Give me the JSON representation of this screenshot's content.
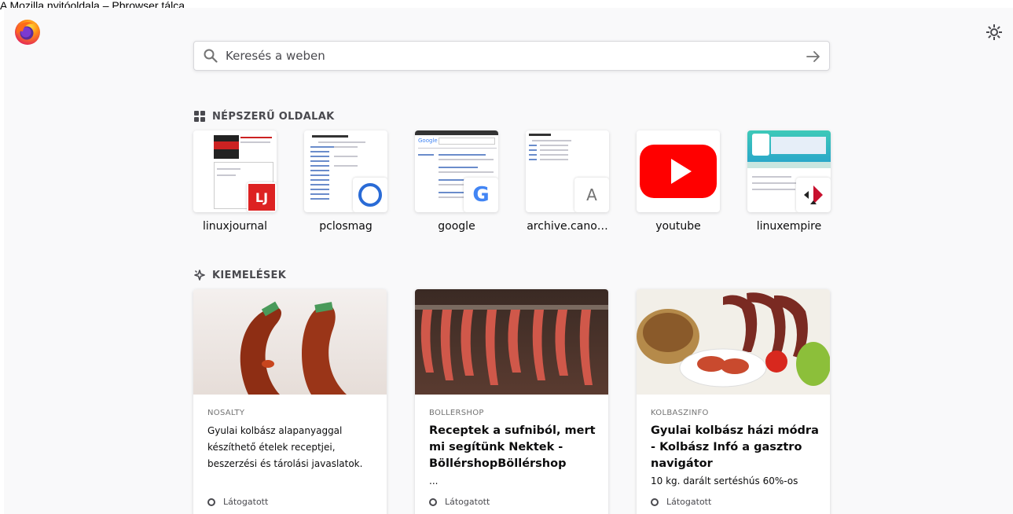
{
  "window": {
    "title": "A Mozilla nyitóoldala – Pbrowser tálca"
  },
  "toolbar": {
    "logo_icon": "firefox-logo",
    "settings_icon": "gear-icon"
  },
  "search": {
    "placeholder": "Keresés a weben",
    "icon": "search-icon",
    "go_icon": "arrow-right-icon"
  },
  "top_sites": {
    "heading": "NÉPSZERŰ OLDALAK",
    "items": [
      {
        "label": "linuxjournal",
        "badge": "LJ"
      },
      {
        "label": "pclosmag",
        "badge": ""
      },
      {
        "label": "google",
        "badge": "G"
      },
      {
        "label": "archive.cano…",
        "badge": "A"
      },
      {
        "label": "youtube",
        "badge": ""
      },
      {
        "label": "linuxempire",
        "badge": ""
      }
    ]
  },
  "highlights": {
    "heading": "KIEMELÉSEK",
    "cards": [
      {
        "source": "NOSALTY",
        "title": "",
        "description": "Gyulai kolbász alapanyaggal készíthető ételek receptjei, beszerzési és tárolási javaslatok.",
        "status": "Látogatott"
      },
      {
        "source": "BOLLERSHOP",
        "title": "Receptek a sufniból, mert mi segítünk Nektek - BöllérshopBöllérshop",
        "description": "...",
        "status": "Látogatott"
      },
      {
        "source": "KOLBASZINFO",
        "title": "Gyulai kolbász házi módra - Kolbász Infó a gasztro navigátor",
        "description": "10 kg. darált sertéshús 60%-os",
        "status": "Látogatott"
      }
    ]
  }
}
